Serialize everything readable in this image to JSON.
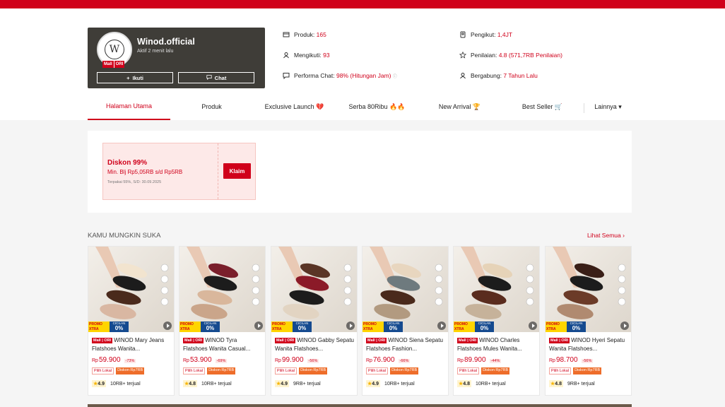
{
  "shop": {
    "name": "Winod.official",
    "status": "Aktif 2 menit lalu",
    "logo_letter": "W",
    "badge": [
      "Mall",
      "ORI"
    ],
    "follow_label": "Ikuti",
    "chat_label": "Chat"
  },
  "stats": [
    {
      "label": "Produk:",
      "value": "165",
      "icon": "store-icon"
    },
    {
      "label": "Mengikuti:",
      "value": "93",
      "icon": "user-icon"
    },
    {
      "label": "Performa Chat:",
      "value": "98% (Hitungan Jam)",
      "icon": "chat-icon"
    },
    {
      "label": "Pengikut:",
      "value": "1,4JT",
      "icon": "followers-icon"
    },
    {
      "label": "Penilaian:",
      "value": "4.8 (571,7RB Penilaian)",
      "icon": "star-icon"
    },
    {
      "label": "Bergabung:",
      "value": "7 Tahun Lalu",
      "icon": "joined-icon"
    }
  ],
  "tabs": [
    "Halaman Utama",
    "Produk",
    "Exclusive Launch 💔",
    "Serba 80Ribu 🔥🔥",
    "New Arrival 🏆",
    "Best Seller 🛒",
    "Lainnya ▾"
  ],
  "voucher": {
    "title": "Diskon 99%",
    "subtitle": "Min. Blj Rp5,05RB s/d Rp5RB",
    "note": "Terpakai 55%, S/D: 30.09.2025",
    "claim_label": "Klaim"
  },
  "section": {
    "title": "KAMU MUNGKIN SUKA",
    "see_all": "Lihat Semua"
  },
  "promo": {
    "xtra": "PROMO XTRA",
    "cicilan": "CICILAN",
    "pct": "0%"
  },
  "products": [
    {
      "badge": "Mall | ORI",
      "name": "WINOD Mary Jeans Flatshoes Wanita...",
      "currency": "Rp",
      "price": "59.900",
      "discount": "-73%",
      "tag1": "Pilih Lokal",
      "tag2": "Diskon Rp7RB",
      "rating": "4.9",
      "sold": "10RB+ terjual",
      "colors": [
        "#f2e4cf",
        "#1c1c1c",
        "#4a2a1c",
        "#d9b7a2"
      ]
    },
    {
      "badge": "Mall | ORI",
      "name": "WINOD Tyra Flatshoes Wanita Casual...",
      "currency": "Rp",
      "price": "53.900",
      "discount": "-69%",
      "tag1": "Pilih Lokal",
      "tag2": "Diskon Rp7RB",
      "rating": "4.8",
      "sold": "10RB+ terjual",
      "colors": [
        "#7a1f2b",
        "#1c1c1c",
        "#d9b79c",
        "#caa58a"
      ]
    },
    {
      "badge": "Mall | ORI",
      "name": "WINOD Gabby Sepatu Wanita Flatshoes...",
      "currency": "Rp",
      "price": "99.900",
      "discount": "-56%",
      "tag1": "Pilih Lokal",
      "tag2": "Diskon Rp7RB",
      "rating": "4.9",
      "sold": "9RB+ terjual",
      "colors": [
        "#5a3526",
        "#8b1a28",
        "#1c1c1c",
        "#e2d4c2"
      ]
    },
    {
      "badge": "Mall | ORI",
      "name": "WINOD Siena Sepatu Flatshoes Fashion...",
      "currency": "Rp",
      "price": "76.900",
      "discount": "-66%",
      "tag1": "Pilih Lokal",
      "tag2": "Diskon Rp7RB",
      "rating": "4.9",
      "sold": "10RB+ terjual",
      "colors": [
        "#e8d6bf",
        "#6e7a7e",
        "#4a2a1c",
        "#b29a80"
      ]
    },
    {
      "badge": "Mall | ORI",
      "name": "WINOD Charles Flatshoes Mules Wanita...",
      "currency": "Rp",
      "price": "89.900",
      "discount": "-44%",
      "tag1": "Pilih Lokal",
      "tag2": "Diskon Rp7RB",
      "rating": "4.8",
      "sold": "10RB+ terjual",
      "colors": [
        "#e6d3b8",
        "#1c1c1c",
        "#5a2c1e",
        "#c6b29a"
      ]
    },
    {
      "badge": "Mall | ORI",
      "name": "WINOD Hyeri Sepatu Wanita Flatshoes...",
      "currency": "Rp",
      "price": "98.700",
      "discount": "-56%",
      "tag1": "Pilih Lokal",
      "tag2": "Diskon Rp7RB",
      "rating": "4.8",
      "sold": "9RB+ terjual",
      "colors": [
        "#3a1f17",
        "#1c1c1c",
        "#6b3b28",
        "#b08a70"
      ]
    }
  ],
  "accent_color": "#d0011b"
}
